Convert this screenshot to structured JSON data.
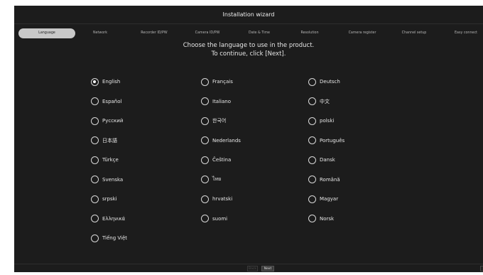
{
  "title": "Installation wizard",
  "steps": [
    {
      "label": "Language",
      "active": true
    },
    {
      "label": "Network",
      "active": false
    },
    {
      "label": "Recorder ID/PW",
      "active": false
    },
    {
      "label": "Camera ID/PW",
      "active": false
    },
    {
      "label": "Date & Time",
      "active": false
    },
    {
      "label": "Resolution",
      "active": false
    },
    {
      "label": "Camera register",
      "active": false
    },
    {
      "label": "Channel setup",
      "active": false
    },
    {
      "label": "Easy connect",
      "active": false
    }
  ],
  "instruction": {
    "line1": "Choose the language to use in the product.",
    "line2": "To continue, click [Next]."
  },
  "languages": [
    {
      "label": "English",
      "selected": true
    },
    {
      "label": "Français",
      "selected": false
    },
    {
      "label": "Deutsch",
      "selected": false
    },
    {
      "label": "Español",
      "selected": false
    },
    {
      "label": "Italiano",
      "selected": false
    },
    {
      "label": "中文",
      "selected": false
    },
    {
      "label": "Русский",
      "selected": false
    },
    {
      "label": "한국어",
      "selected": false
    },
    {
      "label": "polski",
      "selected": false
    },
    {
      "label": "日本語",
      "selected": false
    },
    {
      "label": "Nederlands",
      "selected": false
    },
    {
      "label": "Português",
      "selected": false
    },
    {
      "label": "Türkçe",
      "selected": false
    },
    {
      "label": "Čeština",
      "selected": false
    },
    {
      "label": "Dansk",
      "selected": false
    },
    {
      "label": "Svenska",
      "selected": false
    },
    {
      "label": "ไทย",
      "selected": false
    },
    {
      "label": "Română",
      "selected": false
    },
    {
      "label": "srpski",
      "selected": false
    },
    {
      "label": "hrvatski",
      "selected": false
    },
    {
      "label": "Magyar",
      "selected": false
    },
    {
      "label": "Ελληνικά",
      "selected": false
    },
    {
      "label": "suomi",
      "selected": false
    },
    {
      "label": "Norsk",
      "selected": false
    },
    {
      "label": "Tiếng Việt",
      "selected": false
    }
  ],
  "footer": {
    "back_label": "Back",
    "next_label": "Next"
  }
}
